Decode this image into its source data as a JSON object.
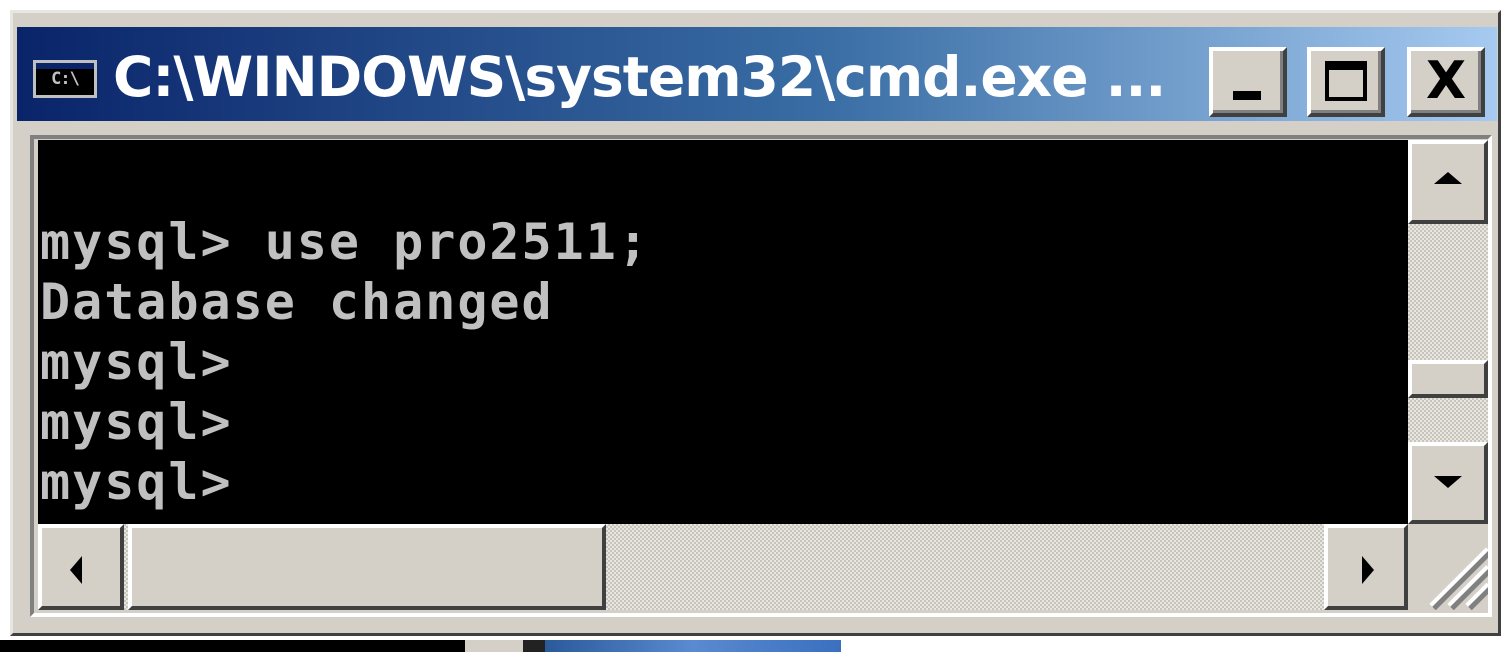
{
  "window": {
    "title": "C:\\WINDOWS\\system32\\cmd.exe ...",
    "icon_label": "C:\\",
    "icon": "cmd-app-icon",
    "caption_buttons": {
      "minimize_icon": "minimize-icon",
      "maximize_icon": "maximize-icon",
      "close_icon": "close-icon",
      "close_glyph": "X"
    }
  },
  "console": {
    "lines": [
      "mysql> use pro2511;",
      "Database changed",
      "mysql>",
      "mysql>",
      "mysql>"
    ],
    "background": "#000000",
    "foreground": "#c0c0c0"
  },
  "scrollbars": {
    "vertical": {
      "up_icon": "arrow-up-icon",
      "down_icon": "arrow-down-icon"
    },
    "horizontal": {
      "left_icon": "arrow-left-icon",
      "right_icon": "arrow-right-icon"
    }
  },
  "colors": {
    "titlebar_start": "#0a246a",
    "titlebar_end": "#a6caf0",
    "chrome": "#d4d0c8"
  }
}
